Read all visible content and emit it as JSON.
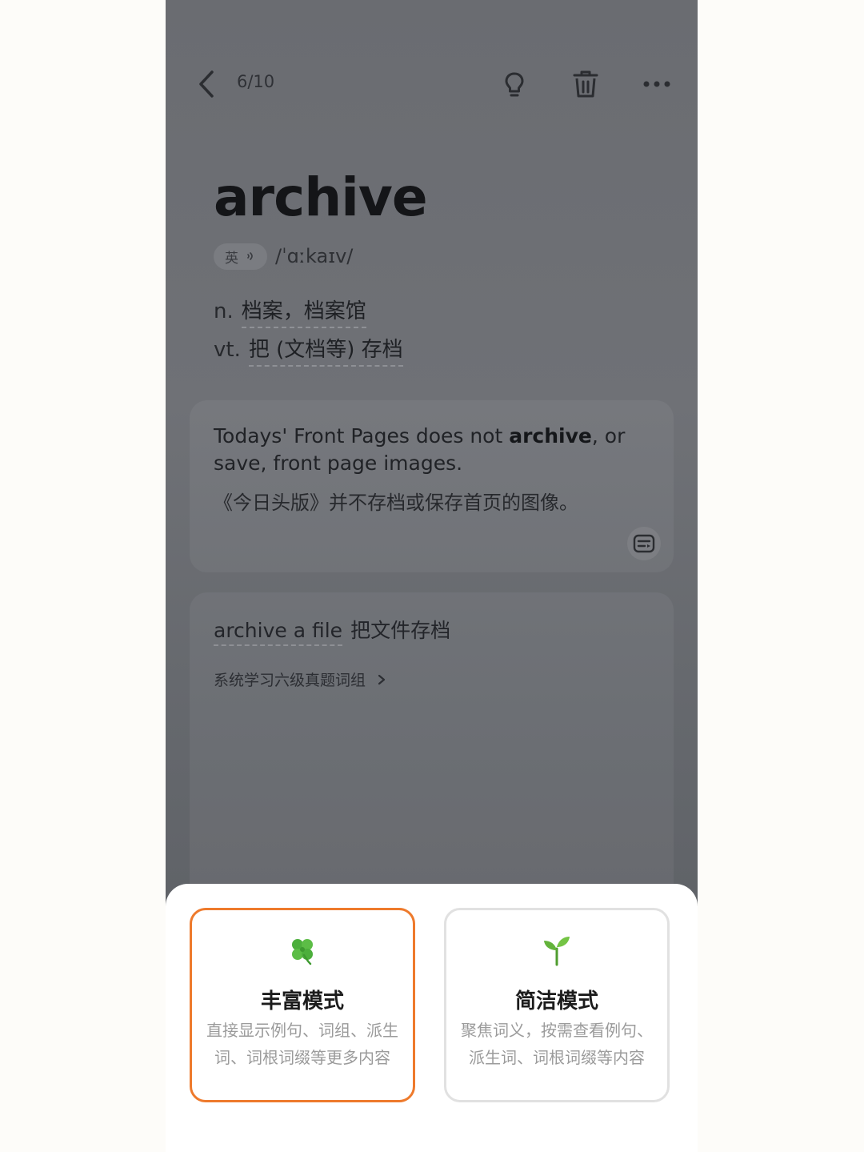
{
  "header": {
    "counter": "6/10",
    "icons": [
      "back-arrow-icon",
      "lightbulb-icon",
      "trash-icon",
      "more-icon"
    ]
  },
  "word": {
    "headword": "archive",
    "accent_label": "英",
    "audio_icon": "speaker-icon",
    "phonetic": "/ˈɑːkaɪv/"
  },
  "definitions": [
    {
      "pos": "n.",
      "meaning": "档案，档案馆"
    },
    {
      "pos": "vt.",
      "meaning": "把 (文档等) 存档"
    }
  ],
  "example": {
    "en_before": "Todays' Front Pages does not ",
    "en_keyword": "archive",
    "en_after": ", or save, front page images.",
    "zh": "《今日头版》并不存档或保存首页的图像。",
    "action_icon": "subtitle-icon"
  },
  "phrase": {
    "en": "archive a file",
    "zh": "把文件存档",
    "group_link": "系统学习六级真题词组",
    "group_link_icon": "chevron-right-icon"
  },
  "modes": [
    {
      "icon": "four-leaf-clover-icon",
      "title": "丰富模式",
      "desc": "直接显示例句、词组、派生词、词根词缀等更多内容",
      "selected": true
    },
    {
      "icon": "seedling-icon",
      "title": "简洁模式",
      "desc": "聚焦词义，按需查看例句、派生词、词根词缀等内容",
      "selected": false
    }
  ],
  "colors": {
    "selected_border": "#ee7a2c",
    "unselected_border": "#e1e1e1"
  }
}
